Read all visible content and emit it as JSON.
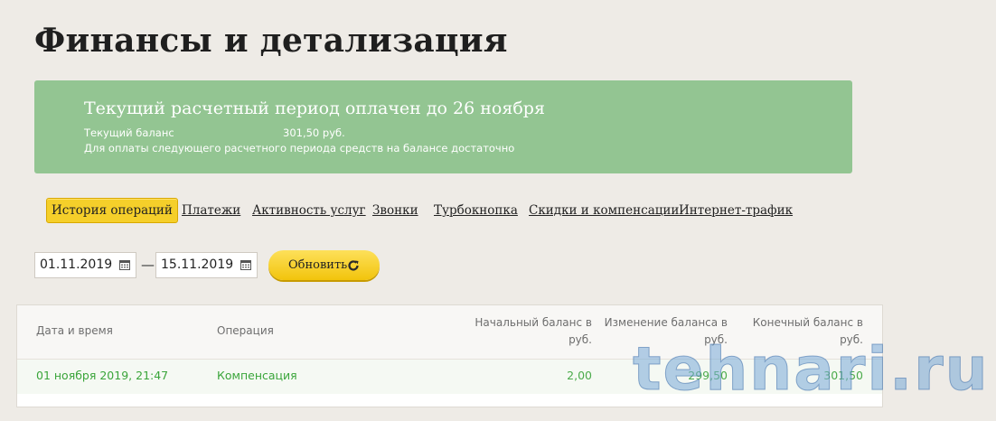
{
  "page": {
    "title": "Финансы и детализация"
  },
  "banner": {
    "headline": "Текущий расчетный период оплачен до 26 ноября",
    "balance_label": "Текущий баланс",
    "balance_value": "301,50 руб.",
    "note": "Для оплаты следующего расчетного периода средств на балансе достаточно",
    "color": "#93c592"
  },
  "tabs": [
    {
      "label": "История операций",
      "active": true
    },
    {
      "label": "Платежи"
    },
    {
      "label": "Активность услуг"
    },
    {
      "label": "Звонки"
    },
    {
      "label": "Турбокнопка"
    },
    {
      "label": "Скидки и компенсации"
    },
    {
      "label": "Интернет-трафик"
    }
  ],
  "filter": {
    "date_from": "01.11.2019",
    "date_to": "15.11.2019",
    "separator": "—",
    "refresh_label": "Обновить",
    "refresh_icon": "refresh-icon",
    "calendar_icon": "calendar-icon",
    "accent": "#f5cf2a"
  },
  "table": {
    "headers": {
      "datetime": "Дата и время",
      "operation": "Операция",
      "start_balance_1": "Начальный баланс в",
      "start_balance_2": "руб.",
      "change_1": "Изменение баланса в",
      "change_2": "руб.",
      "end_balance_1": "Конечный баланс в",
      "end_balance_2": "руб."
    },
    "rows": [
      {
        "datetime": "01 ноября 2019, 21:47",
        "operation": "Компенсация",
        "start_balance": "2,00",
        "change": "299,50",
        "end_balance": "301,50"
      }
    ],
    "value_color": "#3aa53a"
  },
  "watermark": "tehnari.ru"
}
